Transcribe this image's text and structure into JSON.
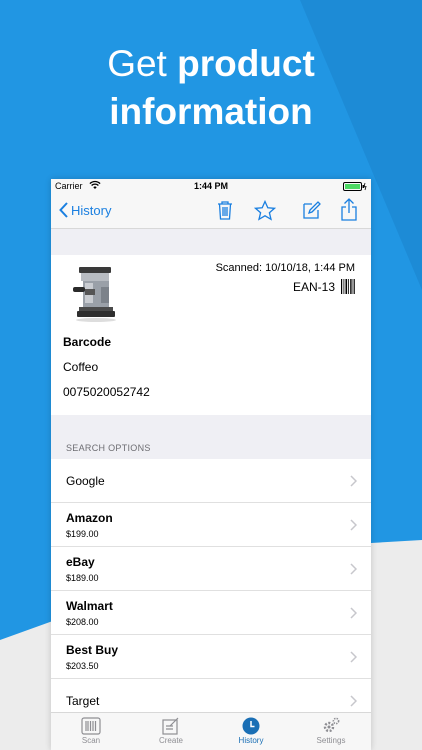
{
  "headline": {
    "line1_light": "Get",
    "line1_bold": "product",
    "line2_bold": "information"
  },
  "status_bar": {
    "carrier": "Carrier",
    "time": "1:44 PM"
  },
  "nav": {
    "back_label": "History"
  },
  "product": {
    "scanned": "Scanned: 10/10/18, 1:44 PM",
    "code_type": "EAN-13",
    "type": "Barcode",
    "name": "Coffeo",
    "code": "0075020052742"
  },
  "search": {
    "section_title": "SEARCH OPTIONS",
    "items": [
      {
        "label": "Google",
        "price": ""
      },
      {
        "label": "Amazon",
        "price": "$199.00"
      },
      {
        "label": "eBay",
        "price": "$189.00"
      },
      {
        "label": "Walmart",
        "price": "$208.00"
      },
      {
        "label": "Best Buy",
        "price": "$203.50"
      },
      {
        "label": "Target",
        "price": ""
      }
    ]
  },
  "tabs": [
    {
      "label": "Scan",
      "icon": "barcode-scan-icon"
    },
    {
      "label": "Create",
      "icon": "create-icon"
    },
    {
      "label": "History",
      "icon": "clock-icon",
      "active": true
    },
    {
      "label": "Settings",
      "icon": "gear-icon"
    }
  ],
  "colors": {
    "background": "#2196e3",
    "accent": "#1a7fe0",
    "tab_active": "#1a6fb5"
  }
}
